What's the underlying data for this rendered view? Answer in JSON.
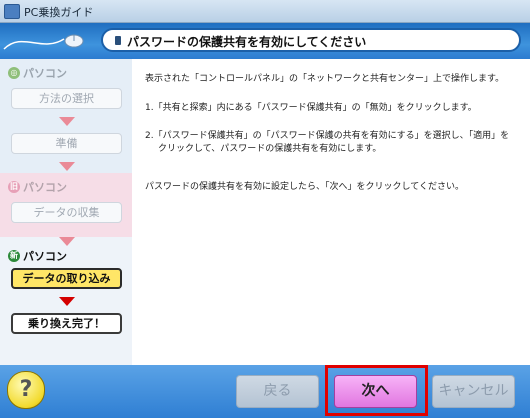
{
  "window": {
    "title": "PC乗換ガイド"
  },
  "header": {
    "banner_text": "パスワードの保護共有を有効にしてください"
  },
  "sidebar": {
    "section1": {
      "badge": "◎",
      "heading": "パソコン",
      "steps": [
        {
          "label": "方法の選択"
        },
        {
          "label": "準備"
        }
      ]
    },
    "section2": {
      "badge": "旧",
      "heading": "パソコン",
      "steps": [
        {
          "label": "データの収集"
        }
      ]
    },
    "section3": {
      "badge": "新",
      "heading": "パソコン",
      "steps": [
        {
          "label": "データの取り込み"
        },
        {
          "label": "乗り換え完了！"
        }
      ]
    }
  },
  "content": {
    "intro": "表示された「コントロールパネル」の「ネットワークと共有センター」上で操作します。",
    "step1": "1.「共有と探索」内にある「パスワード保護共有」の「無効」をクリックします。",
    "step2_line1": "2.「パスワード保護共有」の「パスワード保護の共有を有効にする」を選択し、「適用」を",
    "step2_line2": "クリックして、パスワードの保護共有を有効にします。",
    "outro": "パスワードの保護共有を有効に設定したら、「次へ」をクリックしてください。"
  },
  "footer": {
    "help_label": "?",
    "back_label": "戻る",
    "next_label": "次へ",
    "cancel_label": "キャンセル"
  },
  "colors": {
    "header_blue": "#2c7bd0",
    "active_step": "#ffe667",
    "next_button": "#e176e0",
    "highlight_red": "#e00000"
  }
}
